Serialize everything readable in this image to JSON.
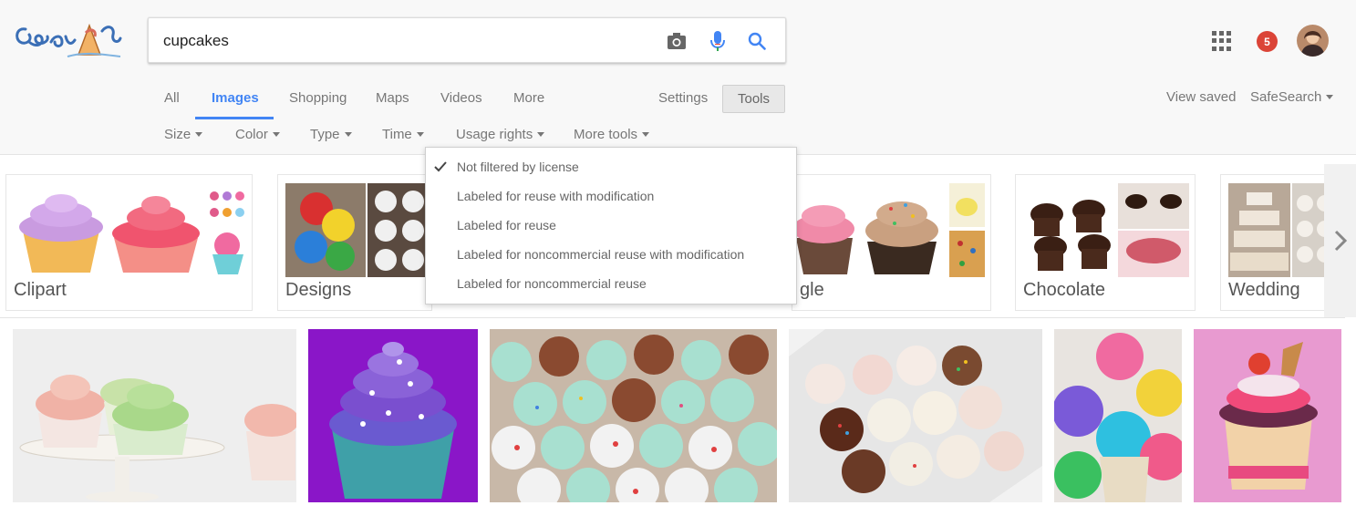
{
  "search": {
    "query": "cupcakes"
  },
  "header": {
    "notification_count": "5",
    "view_saved": "View saved",
    "safesearch": "SafeSearch"
  },
  "nav": {
    "tabs": [
      "All",
      "Images",
      "Shopping",
      "Maps",
      "Videos",
      "More"
    ],
    "active_tab": "Images",
    "settings": "Settings",
    "tools": "Tools"
  },
  "tools_bar": [
    "Size",
    "Color",
    "Type",
    "Time",
    "Usage rights",
    "More tools"
  ],
  "usage_rights_menu": {
    "items": [
      "Not filtered by license",
      "Labeled for reuse with modification",
      "Labeled for reuse",
      "Labeled for noncommercial reuse with modification",
      "Labeled for noncommercial reuse"
    ],
    "selected_index": 0
  },
  "related_searches": [
    "Clipart",
    "Designs",
    "gle",
    "Chocolate",
    "Wedding"
  ],
  "colors": {
    "accent": "#4285f4",
    "badge": "#db4437"
  }
}
